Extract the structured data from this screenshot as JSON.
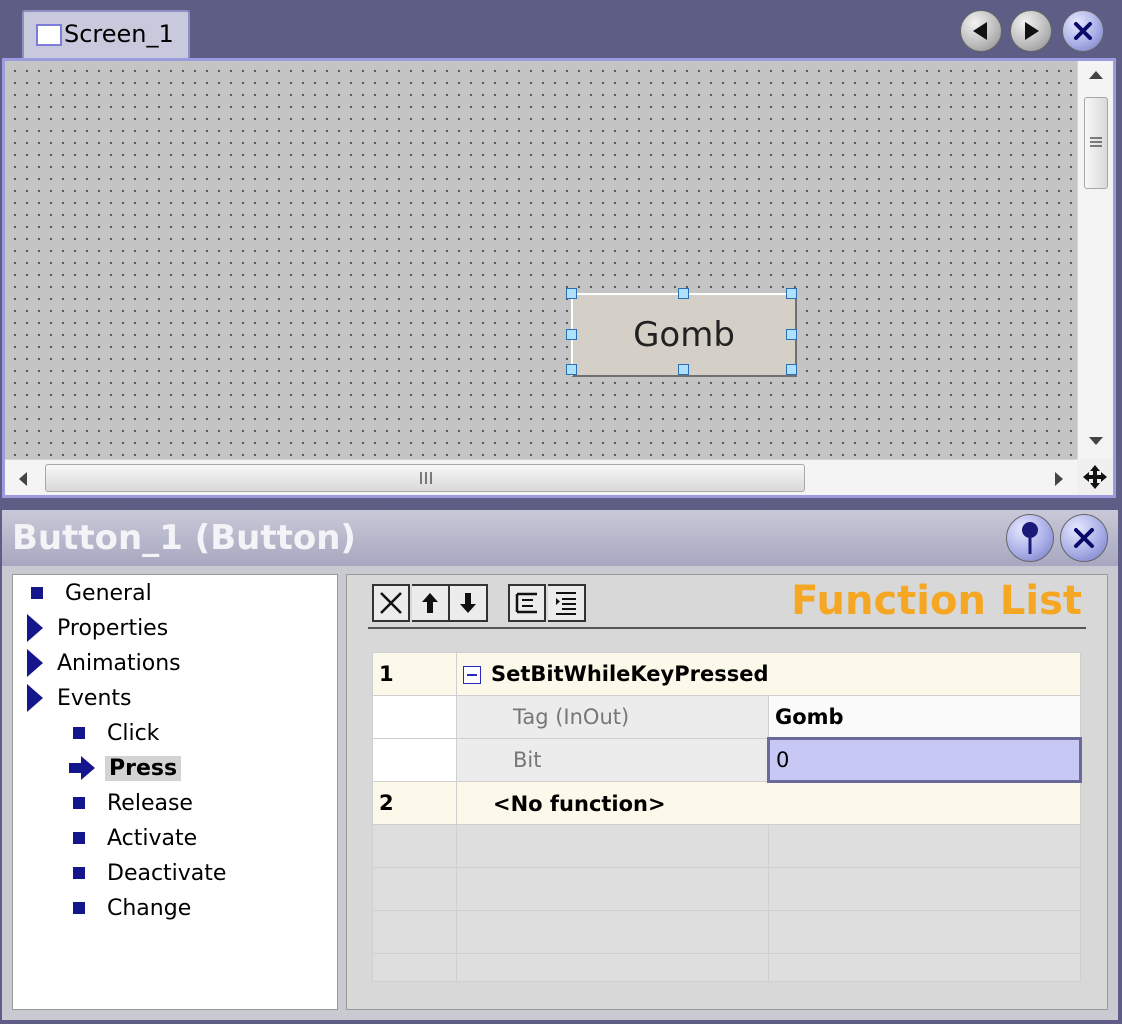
{
  "screen_editor": {
    "tab_label": "Screen_1",
    "button_caption": "Gomb",
    "nav": {
      "prev_icon": "triangle-left",
      "next_icon": "triangle-right",
      "close_icon": "x"
    }
  },
  "inspector": {
    "title": "Button_1 (Button)",
    "pin_icon": "pushpin",
    "close_icon": "x",
    "tree": {
      "general": "General",
      "properties": "Properties",
      "animations": "Animations",
      "events": "Events",
      "click": "Click",
      "press": "Press",
      "release": "Release",
      "activate": "Activate",
      "deactivate": "Deactivate",
      "change": "Change"
    },
    "function_list": {
      "title": "Function List",
      "toolbar_icons": [
        "delete",
        "move-up",
        "move-down",
        "outdent",
        "indent"
      ],
      "rows": [
        {
          "index": "1",
          "function": "SetBitWhileKeyPressed"
        },
        {
          "param": "Tag (InOut)",
          "value": "Gomb"
        },
        {
          "param": "Bit",
          "value": "0"
        },
        {
          "index": "2",
          "function": "<No function>"
        }
      ]
    }
  },
  "colors": {
    "background": "#5d5d85",
    "accent_title": "#f5a623",
    "tree_bullet": "#15158c",
    "selected_cell": "#c8c8f4"
  }
}
